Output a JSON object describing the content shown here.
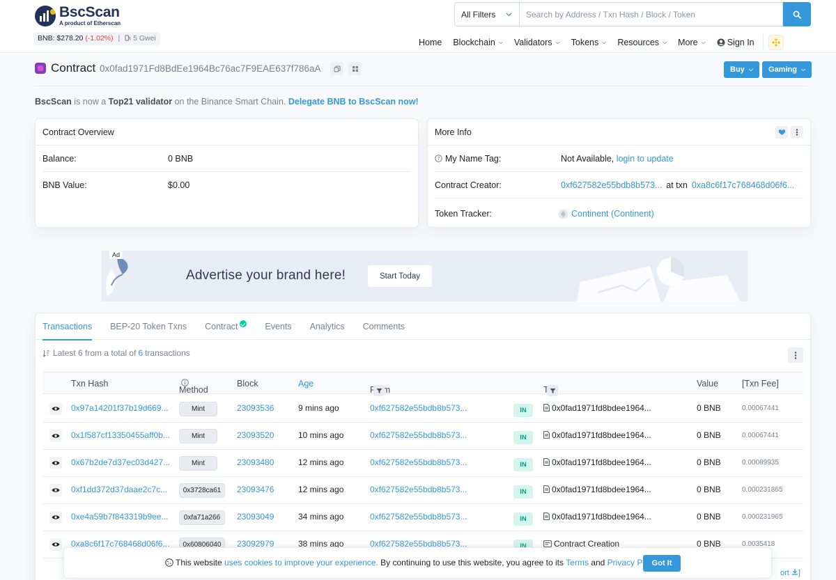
{
  "header": {
    "logo_name": "BscScan",
    "logo_sub": "A product of Etherscan",
    "bnb_price": "BNB: $278.20",
    "bnb_change": "(-1.02%)",
    "gas": "5 Gwei",
    "filter_label": "All Filters",
    "search_placeholder": "Search by Address / Txn Hash / Block / Token",
    "nav": {
      "home": "Home",
      "blockchain": "Blockchain",
      "validators": "Validators",
      "tokens": "Tokens",
      "resources": "Resources",
      "more": "More",
      "sign_in": "Sign In"
    }
  },
  "title": {
    "label": "Contract",
    "address": "0x0fad1971Fd8BdEe1964Bc76ac7F9EAE637f786aA",
    "buy": "Buy",
    "gaming": "Gaming"
  },
  "announcement": {
    "brand": "BscScan",
    "text1": " is now a ",
    "highlight": "Top21 validator",
    "text2": " on the Binance Smart Chain. ",
    "cta": "Delegate BNB to BscScan now!"
  },
  "overview": {
    "title": "Contract Overview",
    "balance_label": "Balance:",
    "balance_value": "0 BNB",
    "value_label": "BNB Value:",
    "value_value": "$0.00"
  },
  "more_info": {
    "title": "More Info",
    "name_tag_label": "My Name Tag:",
    "name_tag_value": "Not Available, ",
    "name_tag_link": "login to update",
    "creator_label": "Contract Creator:",
    "creator_address": "0xf627582e55bdb8b573...",
    "creator_at": "at txn",
    "creator_txn": "0xa8c6f17c768468d06f6...",
    "tracker_label": "Token Tracker:",
    "tracker_value": "Continent (Continent)"
  },
  "ad": {
    "label": "Ad",
    "text": "Advertise your brand here!",
    "button": "Start Today"
  },
  "tabs": [
    "Transactions",
    "BEP-20 Token Txns",
    "Contract",
    "Events",
    "Analytics",
    "Comments"
  ],
  "summary": {
    "prefix": "Latest 6 from a total of",
    "count": "6",
    "suffix": "transactions"
  },
  "table": {
    "headers": {
      "hash": "Txn Hash",
      "method": "Method",
      "block": "Block",
      "age": "Age",
      "from": "From",
      "to": "To",
      "value": "Value",
      "fee": "[Txn Fee]"
    },
    "rows": [
      {
        "hash": "0x97a14201f37b19d669...",
        "method": "Mint",
        "block": "23093536",
        "age": "9 mins ago",
        "from": "0xf627582e55bdb8b573...",
        "dir": "IN",
        "to": "0x0fad1971fd8bdee1964...",
        "value": "0 BNB",
        "fee": "0.00067441"
      },
      {
        "hash": "0x1f587cf13350455aff0b...",
        "method": "Mint",
        "block": "23093520",
        "age": "10 mins ago",
        "from": "0xf627582e55bdb8b573...",
        "dir": "IN",
        "to": "0x0fad1971fd8bdee1964...",
        "value": "0 BNB",
        "fee": "0.00067441"
      },
      {
        "hash": "0x67b2de7d37ec03d427...",
        "method": "Mint",
        "block": "23093480",
        "age": "12 mins ago",
        "from": "0xf627582e55bdb8b573...",
        "dir": "IN",
        "to": "0x0fad1971fd8bdee1964...",
        "value": "0 BNB",
        "fee": "0.00089935"
      },
      {
        "hash": "0xf1dd372d37daae2c7c...",
        "method": "0x3728ca61",
        "block": "23093476",
        "age": "12 mins ago",
        "from": "0xf627582e55bdb8b573...",
        "dir": "IN",
        "to": "0x0fad1971fd8bdee1964...",
        "value": "0 BNB",
        "fee": "0.000231865"
      },
      {
        "hash": "0xe4a59b7f843319b9ee...",
        "method": "0xfa71a266",
        "block": "23093049",
        "age": "34 mins ago",
        "from": "0xf627582e55bdb8b573...",
        "dir": "IN",
        "to": "0x0fad1971fd8bdee1964...",
        "value": "0 BNB",
        "fee": "0.000231965"
      },
      {
        "hash": "0xa8c6f17c768468d06f6...",
        "method": "0x60806040",
        "block": "23092979",
        "age": "38 mins ago",
        "from": "0xf627582e55bdb8b573...",
        "dir": "IN",
        "to": "Contract Creation",
        "value": "0 BNB",
        "fee": "0.0035418"
      }
    ]
  },
  "cookie": {
    "text1": "This website ",
    "link1": "uses cookies to improve your experience.",
    "text2": " By continuing to use this website, you agree to its ",
    "terms": "Terms",
    "and": " and ",
    "privacy": "Privacy Policy.",
    "button": "Got It"
  },
  "export_fragment": "ort",
  "colors": {
    "primary": "#3498db",
    "success": "#00c9a7",
    "danger": "#de4437",
    "bnb": "#f0b90b",
    "navy": "#21325b"
  }
}
